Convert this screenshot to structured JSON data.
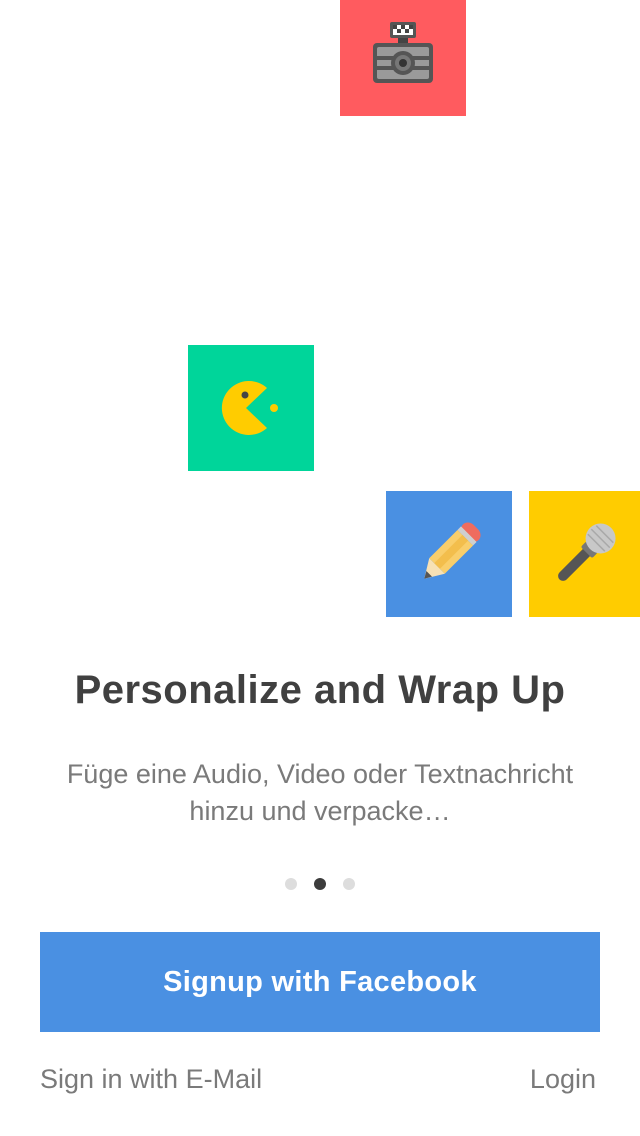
{
  "tiles": [
    {
      "icon": "camera-icon",
      "color": "#ff5b5f"
    },
    {
      "icon": "pacman-icon",
      "color": "#00d59a"
    },
    {
      "icon": "pencil-icon",
      "color": "#4a90e2"
    },
    {
      "icon": "microphone-icon",
      "color": "#ffcc00"
    }
  ],
  "onboarding": {
    "title": "Personalize and Wrap Up",
    "subtitle": "Füge eine Audio, Video oder Textnachricht hinzu und verpacke…",
    "page_index": 2,
    "page_count": 3
  },
  "actions": {
    "facebook_label": "Signup with Facebook",
    "email_label": "Sign in with E-Mail",
    "login_label": "Login"
  },
  "colors": {
    "facebook_button": "#4a90e2",
    "title_text": "#404040",
    "body_text": "#7a7a7a",
    "dot_active": "#3c3c3c",
    "dot_inactive": "#dddddd"
  }
}
